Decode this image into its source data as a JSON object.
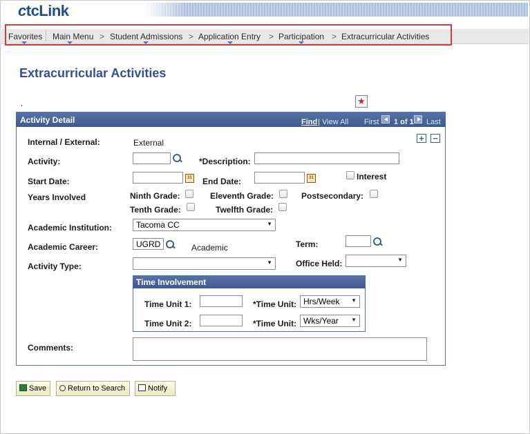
{
  "logo": {
    "text_c": "c",
    "text_rest": "tcLink"
  },
  "nav": {
    "items": [
      "Favorites",
      "Main Menu",
      "Student Admissions",
      "Application Entry",
      "Participation",
      "Extracurricular Activities"
    ],
    "separator": ">"
  },
  "page": {
    "title": "Extracurricular Activities",
    "tick": ","
  },
  "panel": {
    "title": "Activity Detail",
    "find": "Find",
    "pipe": "|",
    "view_all": "View All",
    "first": "First",
    "pager": "1 of 1",
    "last": "Last",
    "add": "+",
    "remove": "−"
  },
  "form": {
    "internal_external_label": "Internal / External:",
    "internal_external_value": "External",
    "activity_label": "Activity:",
    "activity_value": "",
    "description_label": "*Description:",
    "description_value": "",
    "start_date_label": "Start Date:",
    "start_date_value": "",
    "end_date_label": "End Date:",
    "end_date_value": "",
    "interest_label": "Interest",
    "years_involved_label": "Years Involved",
    "ninth_grade": "Ninth Grade:",
    "eleventh_grade": "Eleventh Grade:",
    "postsecondary": "Postsecondary:",
    "tenth_grade": "Tenth Grade:",
    "twelfth_grade": "Twelfth Grade:",
    "academic_institution_label": "Academic Institution:",
    "academic_institution_value": "Tacoma CC",
    "academic_career_label": "Academic Career:",
    "academic_career_value": "UGRD",
    "academic_career_desc": "Academic",
    "term_label": "Term:",
    "term_value": "",
    "activity_type_label": "Activity Type:",
    "activity_type_value": "",
    "office_held_label": "Office Held:",
    "office_held_value": "",
    "comments_label": "Comments:",
    "calendar_glyph": "31"
  },
  "time_involvement": {
    "title": "Time Involvement",
    "unit1_label": "Time Unit 1:",
    "unit1_value": "",
    "unit2_label": "Time Unit 2:",
    "unit2_value": "",
    "time_unit_label": "*Time Unit:",
    "time_unit1_value": "Hrs/Week",
    "time_unit2_value": "Wks/Year"
  },
  "buttons": {
    "save": "Save",
    "return_to_search": "Return to Search",
    "notify": "Notify"
  },
  "icons": {
    "favorite": "star-icon",
    "lookup": "search-icon",
    "calendar": "calendar-icon",
    "save": "save-icon",
    "return": "return-icon",
    "notify": "notify-icon"
  },
  "colors": {
    "brand": "#1f4e86",
    "header": "#3f5a92",
    "title": "#32509a",
    "highlight": "#d53c3c",
    "button_bg": "#ecebc4"
  }
}
